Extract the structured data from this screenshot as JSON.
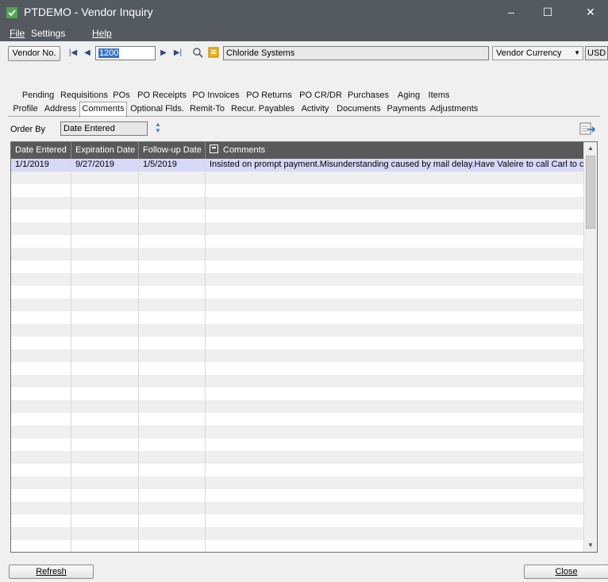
{
  "window": {
    "title": "PTDEMO - Vendor Inquiry",
    "minimize": "–",
    "maximize": "☐",
    "close": "✕"
  },
  "menu": {
    "file": "File",
    "settings": "Settings",
    "help": "Help"
  },
  "toolbar": {
    "vendor_button": "Vendor No.",
    "vendor_no": "1200",
    "vendor_name": "Chloride Systems",
    "currency_select": "Vendor Currency",
    "currency_code": "USD"
  },
  "tabs_row1": [
    "Pending",
    "Requisitions",
    "POs",
    "PO Receipts",
    "PO Invoices",
    "PO Returns",
    "PO CR/DR",
    "Purchases",
    "Aging",
    "Items"
  ],
  "tabs_row2": [
    "Profile",
    "Address",
    "Comments",
    "Optional Flds.",
    "Remit-To",
    "Recur. Payables",
    "Activity",
    "Documents",
    "Payments",
    "Adjustments"
  ],
  "active_tab": "Comments",
  "order_by": {
    "label": "Order By",
    "value": "Date Entered"
  },
  "grid": {
    "columns": [
      "Date Entered",
      "Expiration Date",
      "Follow-up Date",
      "Comments"
    ],
    "rows": [
      [
        "1/1/2019",
        "9/27/2019",
        "1/5/2019",
        "Insisted on prompt payment.Misunderstanding caused by mail delay.Have Valeire to call Carl to clarify."
      ]
    ]
  },
  "buttons": {
    "refresh": "Refresh",
    "close": "Close"
  },
  "icons": [
    "app-check-icon",
    "first-record-icon",
    "previous-record-icon",
    "next-record-icon",
    "last-record-icon",
    "search-icon",
    "note-icon",
    "export-icon",
    "sort-arrows-icon",
    "comment-column-icon"
  ]
}
